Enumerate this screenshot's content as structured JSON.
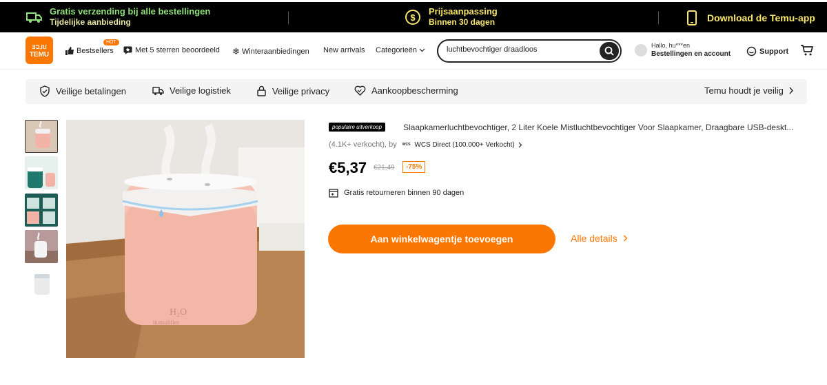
{
  "topbar": {
    "shipping_title": "Gratis verzending bij alle bestellingen",
    "shipping_sub": "Tijdelijke aanbieding",
    "price_title": "Prijsaanpassing",
    "price_sub": "Binnen 30 dagen",
    "app_label": "Download de Temu-app"
  },
  "header": {
    "logo_top": "ƎƆ⅃ᑌ",
    "logo_text": "TEMU",
    "hot_badge": "HOT",
    "nav": {
      "bestsellers": "Bestsellers",
      "five_stars": "Met 5 sterren beoordeeld",
      "winter": "Winteraanbiedingen",
      "new_arrivals": "New arrivals",
      "categories": "Categorieën"
    },
    "search": {
      "value": "luchtbevochtiger draadloos"
    },
    "account": {
      "hello": "Hallo, hu***en",
      "label": "Bestellingen en account"
    },
    "support": "Support"
  },
  "safety": {
    "payments": "Veilige betalingen",
    "logistics": "Veilige logistiek",
    "privacy": "Veilige privacy",
    "protection": "Aankoopbescherming",
    "keeps_safe": "Temu houdt je veilig"
  },
  "product": {
    "badge": "populaire uitverkoop",
    "title": "Slaapkamerluchtbevochtiger, 2 Liter Koele Mistluchtbevochtiger Voor Slaapkamer, Draagbare USB-deskt...",
    "sold": "(4.1K+ verkocht), by",
    "seller_logo": "WCS",
    "seller": "WCS Direct (100.000+ Verkocht)",
    "price": "€5,37",
    "old_price": "€21,49",
    "discount": "-75%",
    "returns": "Gratis retourneren binnen 90 dagen",
    "add_to_cart": "Aan winkelwagentje toevoegen",
    "all_details": "Alle details",
    "image_text_1": "H₂O",
    "image_text_2": "humidifier"
  },
  "colors": {
    "accent": "#fb7701",
    "topbar_green": "#8ee07a",
    "topbar_yellow": "#f7e66a"
  }
}
